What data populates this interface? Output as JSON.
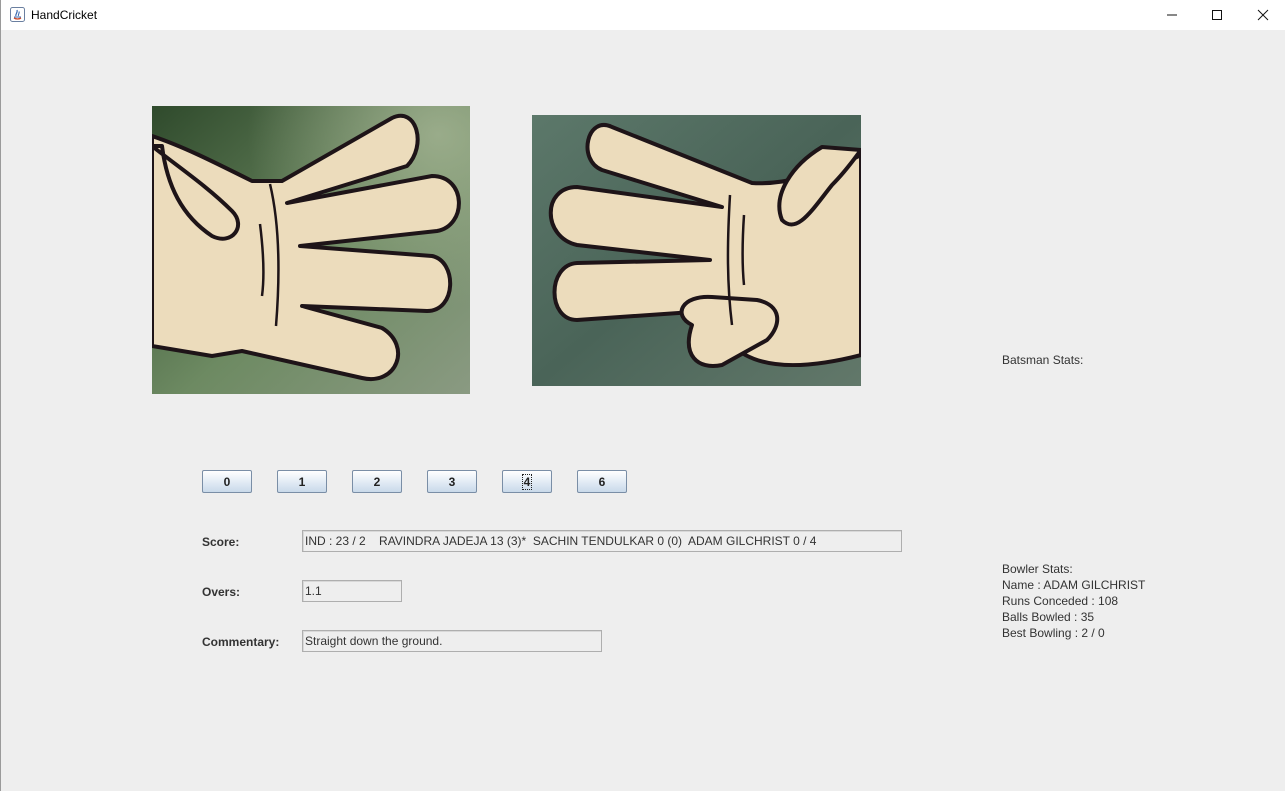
{
  "window": {
    "title": "HandCricket"
  },
  "images": {
    "left_hand": {
      "alt": "open-palm-hand-gesture",
      "background": "#5f7a55"
    },
    "right_hand": {
      "alt": "four-fingers-hand-gesture",
      "background": "#4f6a5f"
    }
  },
  "run_buttons": [
    "0",
    "1",
    "2",
    "3",
    "4",
    "6"
  ],
  "focused_button": "4",
  "score": {
    "label": "Score:",
    "value": "IND : 23 / 2    RAVINDRA JADEJA 13 (3)*  SACHIN TENDULKAR 0 (0)  ADAM GILCHRIST 0 / 4"
  },
  "overs": {
    "label": "Overs:",
    "value": "1.1"
  },
  "commentary": {
    "label": "Commentary:",
    "value": "Straight down the ground."
  },
  "batsman_stats": {
    "title": "Batsman Stats:"
  },
  "bowler_stats": {
    "title": "Bowler Stats:",
    "lines": [
      "Name : ADAM GILCHRIST",
      "Runs Conceded : 108",
      "Balls Bowled : 35",
      "Best Bowling : 2 / 0"
    ]
  }
}
